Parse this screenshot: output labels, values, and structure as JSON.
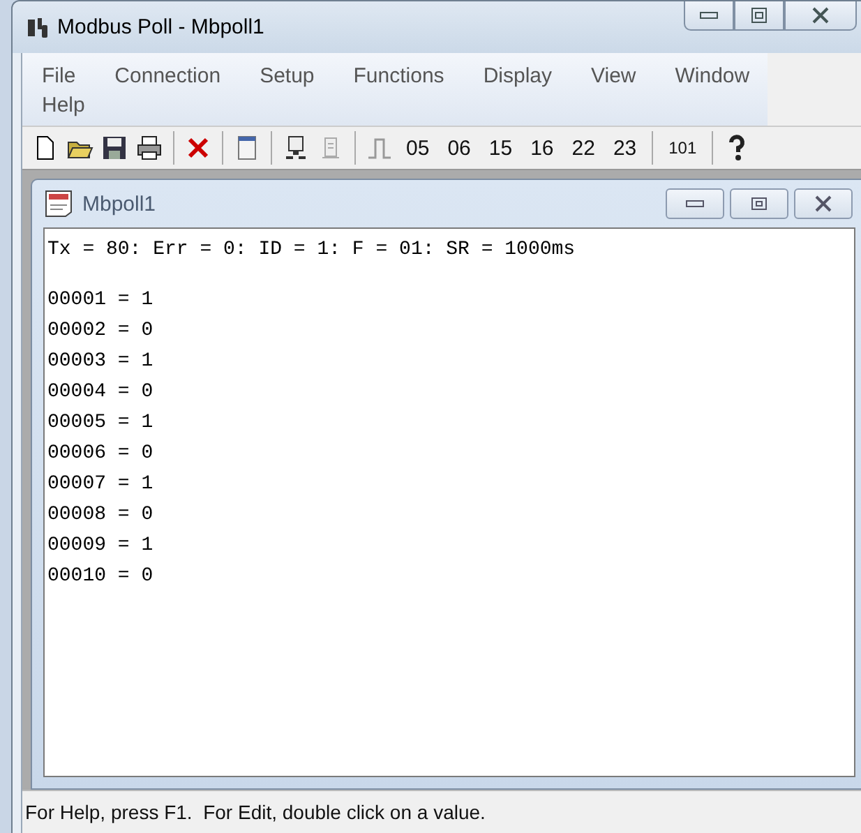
{
  "window": {
    "title": "Modbus Poll - Mbpoll1"
  },
  "menu": [
    "File",
    "Connection",
    "Setup",
    "Functions",
    "Display",
    "View",
    "Window",
    "Help"
  ],
  "toolbar": {
    "function_codes": [
      "05",
      "06",
      "15",
      "16",
      "22",
      "23"
    ],
    "address_button": "101"
  },
  "child_window": {
    "title": "Mbpoll1",
    "summary": "Tx = 80: Err = 0: ID = 1: F = 01: SR = 1000ms",
    "rows": [
      "00001 = 1",
      "00002 = 0",
      "00003 = 1",
      "00004 = 0",
      "00005 = 1",
      "00006 = 0",
      "00007 = 1",
      "00008 = 0",
      "00009 = 1",
      "00010 = 0"
    ]
  },
  "status_bar": "For Help, press F1.  For Edit, double click on a value."
}
